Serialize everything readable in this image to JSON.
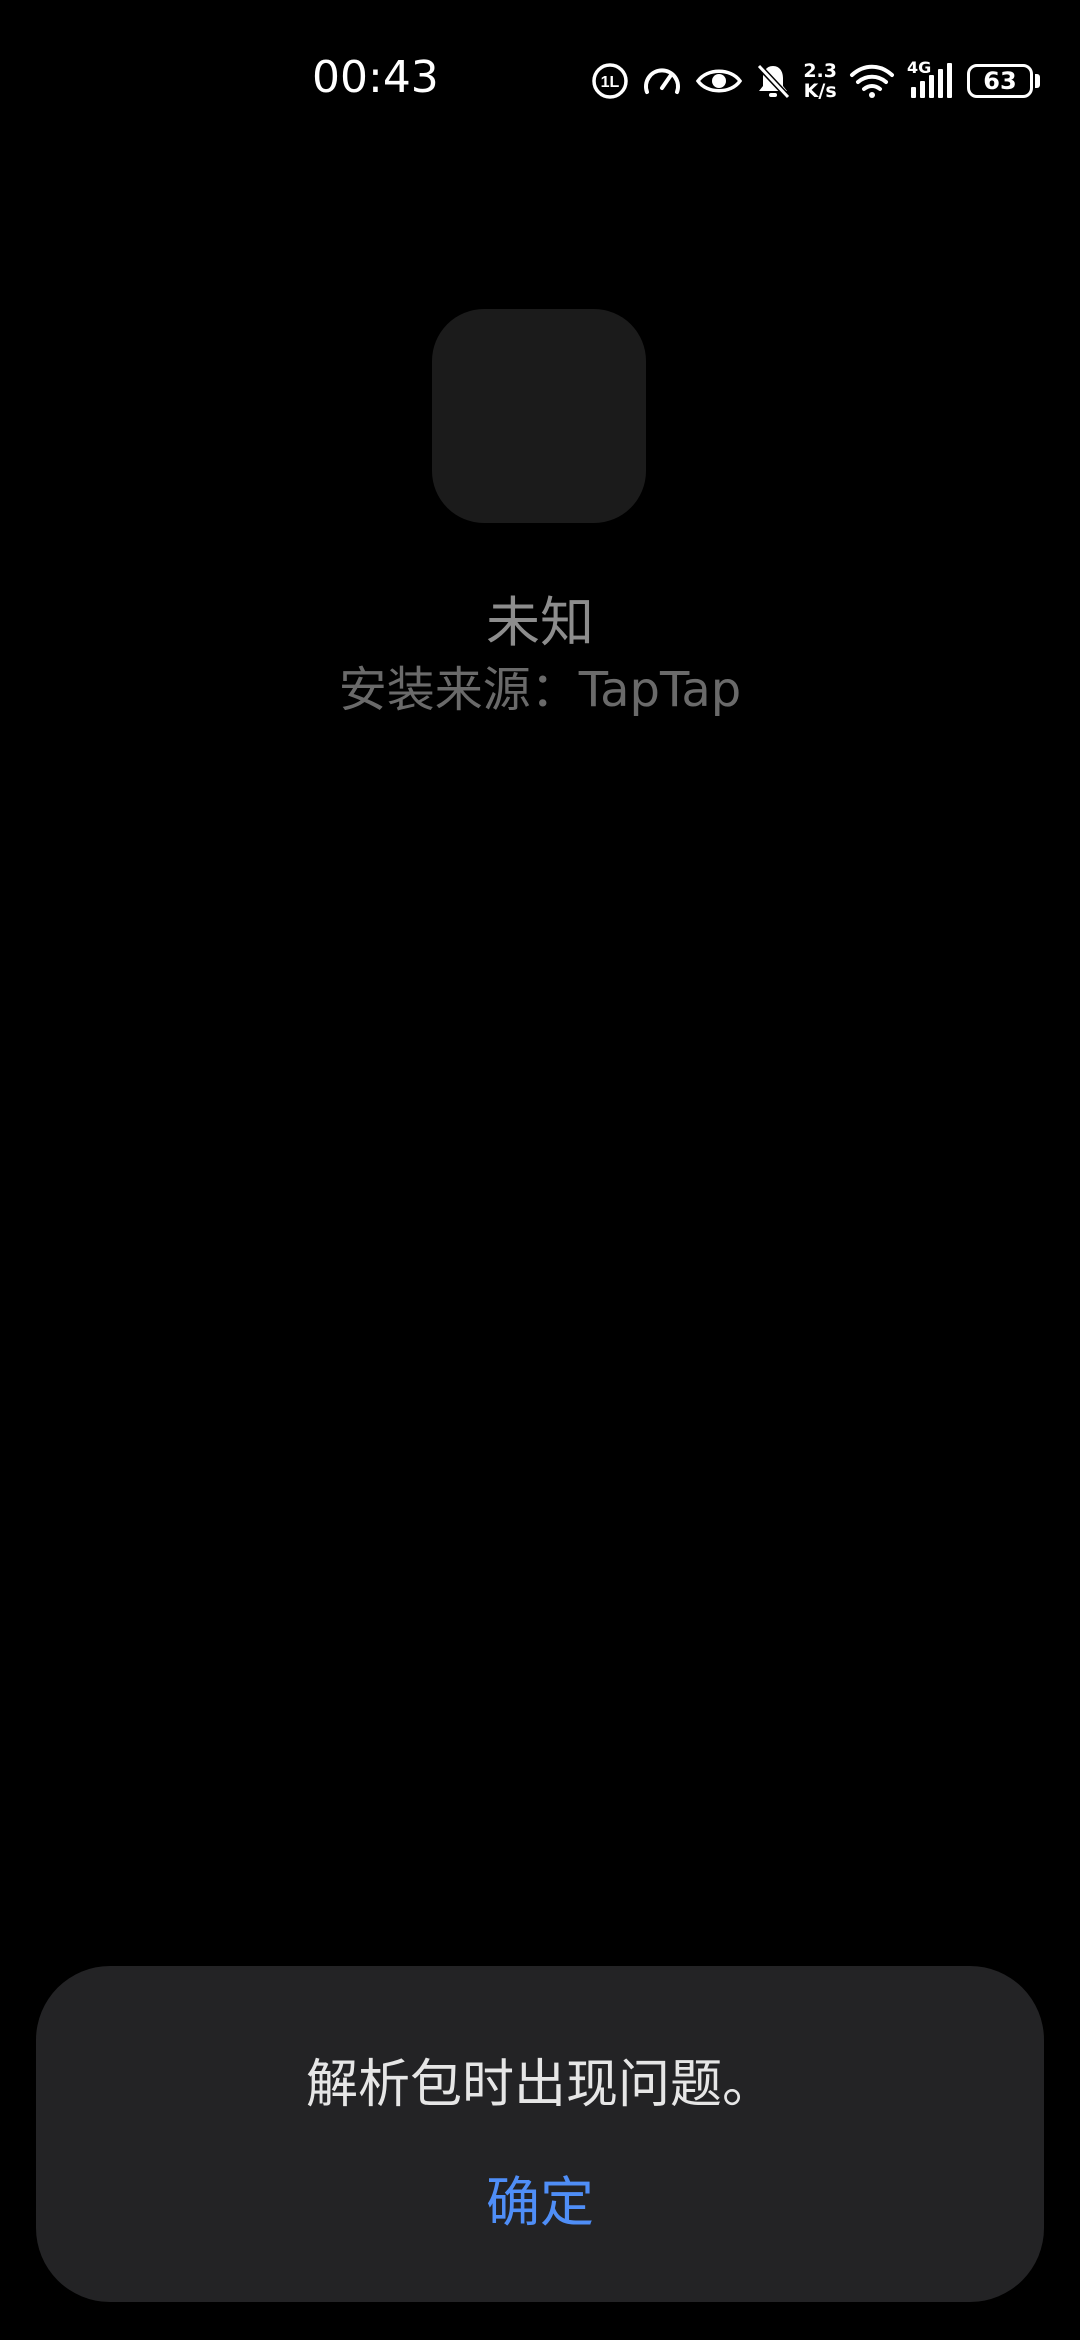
{
  "status_bar": {
    "time": "00:43",
    "network_speed_value": "2.3",
    "network_speed_unit": "K/s",
    "network_type": "4G",
    "battery_level": "63",
    "icons": [
      "hd-call-icon",
      "speedometer-icon",
      "eye-icon",
      "bell-off-icon",
      "wifi-icon",
      "signal-icon",
      "battery-icon"
    ]
  },
  "app": {
    "name": "未知",
    "source": "安装来源：TapTap"
  },
  "dialog": {
    "message": "解析包时出现问题。",
    "confirm_label": "确定"
  },
  "colors": {
    "background": "#000000",
    "dialog_background": "#232325",
    "accent": "#4f8ef7"
  }
}
